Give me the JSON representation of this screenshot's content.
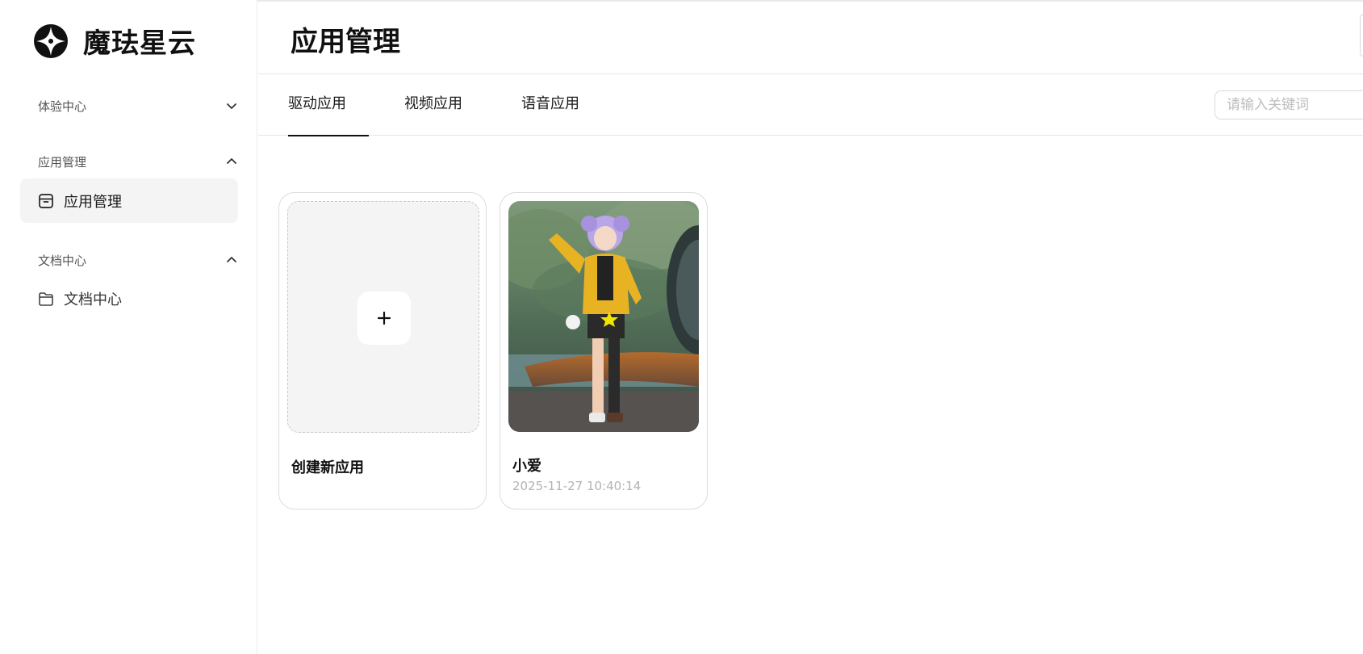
{
  "brand": {
    "name": "魔珐星云",
    "logo_icon": "brand-logo-icon"
  },
  "sidebar": {
    "groups": [
      {
        "label": "体验中心",
        "expanded": false,
        "items": []
      },
      {
        "label": "应用管理",
        "expanded": true,
        "items": [
          {
            "label": "应用管理",
            "icon": "archive-box-icon",
            "active": true
          }
        ]
      },
      {
        "label": "文档中心",
        "expanded": true,
        "items": [
          {
            "label": "文档中心",
            "icon": "folder-icon",
            "active": false
          }
        ]
      }
    ]
  },
  "header": {
    "title": "应用管理"
  },
  "tabs": [
    {
      "label": "驱动应用",
      "active": true
    },
    {
      "label": "视频应用",
      "active": false
    },
    {
      "label": "语音应用",
      "active": false
    }
  ],
  "search": {
    "placeholder": "请输入关键词"
  },
  "cards": {
    "create": {
      "label": "创建新应用",
      "icon": "plus-icon"
    },
    "apps": [
      {
        "name": "小爱",
        "timestamp": "2025-11-27 10:40:14"
      }
    ]
  }
}
